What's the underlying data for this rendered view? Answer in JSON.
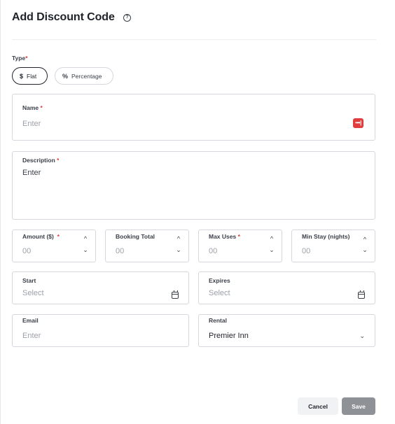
{
  "header": {
    "title": "Add Discount Code",
    "help_icon_glyph": "?"
  },
  "type": {
    "label": "Type",
    "required_mark": "*",
    "options": [
      {
        "label": "Flat",
        "icon": "dollar-icon",
        "glyph": "$",
        "selected": true
      },
      {
        "label": "Percentage",
        "icon": "percent-icon",
        "glyph": "%",
        "selected": false
      }
    ]
  },
  "name": {
    "label": "Name",
    "required_mark": "*",
    "placeholder": "Enter",
    "icon": "password-key-icon",
    "icon_glyph": "•••|"
  },
  "description": {
    "label": "Description",
    "required_mark": "*",
    "placeholder": "Enter"
  },
  "amount": {
    "label": "Amount ($)",
    "required_mark": "*",
    "placeholder": "00"
  },
  "booking_total": {
    "label": "Booking Total",
    "placeholder": "00"
  },
  "max_uses": {
    "label": "Max Uses",
    "required_mark": "*",
    "placeholder": "00"
  },
  "min_stay": {
    "label": "Min Stay (nights)",
    "placeholder": "00"
  },
  "start": {
    "label": "Start",
    "placeholder": "Select"
  },
  "expires": {
    "label": "Expires",
    "placeholder": "Select"
  },
  "email": {
    "label": "Email",
    "placeholder": "Enter"
  },
  "rental": {
    "label": "Rental",
    "value": "Premier Inn"
  },
  "glyphs": {
    "up": "^",
    "down": "⌄"
  },
  "actions": {
    "cancel_label": "Cancel",
    "save_label": "Save"
  },
  "colors": {
    "required": "#d93b3b",
    "key_icon": "#e23d3d",
    "save_disabled": "#8e9196",
    "cancel_bg": "#f1f2f4"
  }
}
